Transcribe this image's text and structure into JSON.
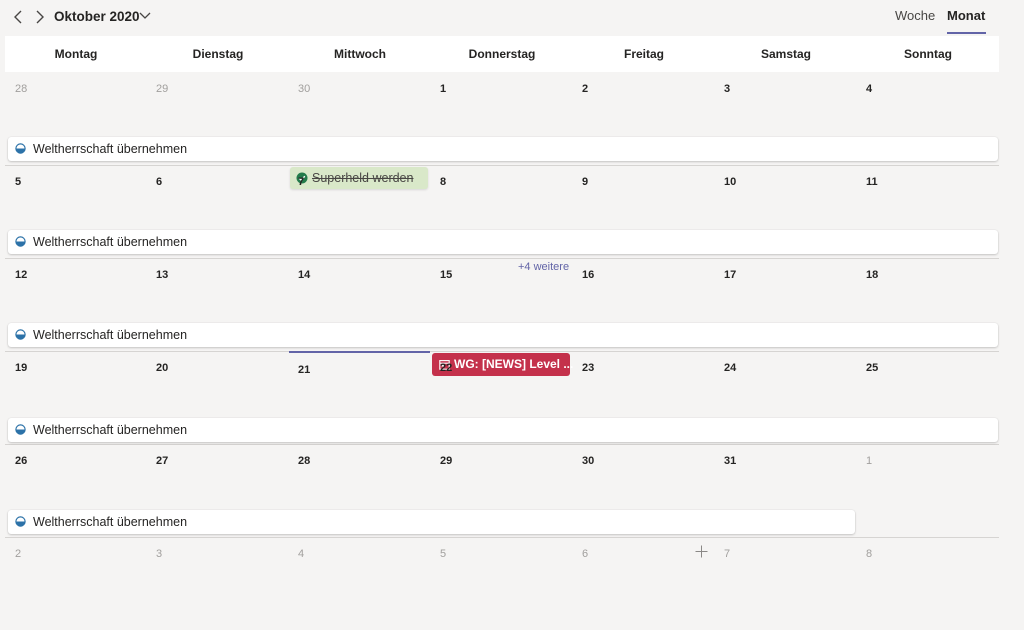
{
  "header": {
    "month_title": "Oktober 2020",
    "view_week": "Woche",
    "view_month": "Monat"
  },
  "weekdays": [
    "Montag",
    "Dienstag",
    "Mittwoch",
    "Donnerstag",
    "Freitag",
    "Samstag",
    "Sonntag"
  ],
  "weeks": [
    [
      "28",
      "29",
      "30",
      "1",
      "2",
      "3",
      "4"
    ],
    [
      "5",
      "6",
      "7",
      "8",
      "9",
      "10",
      "11"
    ],
    [
      "12",
      "13",
      "14",
      "15",
      "16",
      "17",
      "18"
    ],
    [
      "19",
      "20",
      "21",
      "22",
      "23",
      "24",
      "25"
    ],
    [
      "26",
      "27",
      "28",
      "29",
      "30",
      "31",
      "1"
    ],
    [
      "2",
      "3",
      "4",
      "5",
      "6",
      "7",
      "8"
    ]
  ],
  "events": {
    "recurring_title": "Weltherrschaft übernehmen",
    "done_title": "Superheld werden",
    "red_title": "WG: [NEWS] Level ...",
    "more_label": "+4 weitere"
  },
  "colors": {
    "accent": "#6264a7",
    "done_bg": "#d9e8c9",
    "done_check": "#237b4b",
    "red_event": "#c4314b",
    "half_icon": "#2c72a8"
  }
}
